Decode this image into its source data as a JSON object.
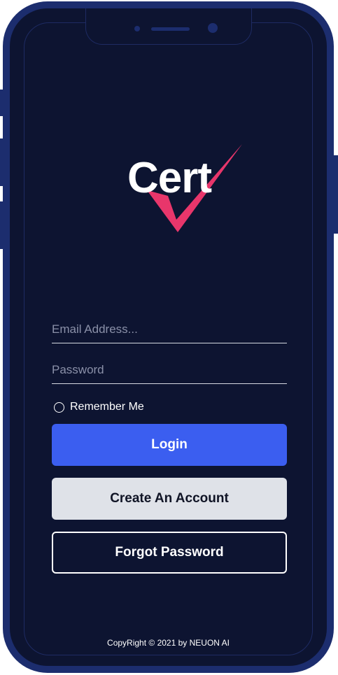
{
  "app": {
    "logo_text": "Cert"
  },
  "login_form": {
    "email_placeholder": "Email Address...",
    "password_placeholder": "Password",
    "remember_label": "Remember Me",
    "remember_checked": false,
    "login_label": "Login",
    "create_account_label": "Create An Account",
    "forgot_password_label": "Forgot Password"
  },
  "footer": {
    "copyright": "CopyRight © 2021 by NEUON AI"
  },
  "colors": {
    "background": "#0d1431",
    "frame": "#1c2d6e",
    "accent_check": "#e8366b",
    "primary_button": "#3b5ef0",
    "secondary_button": "#dfe2e8"
  }
}
